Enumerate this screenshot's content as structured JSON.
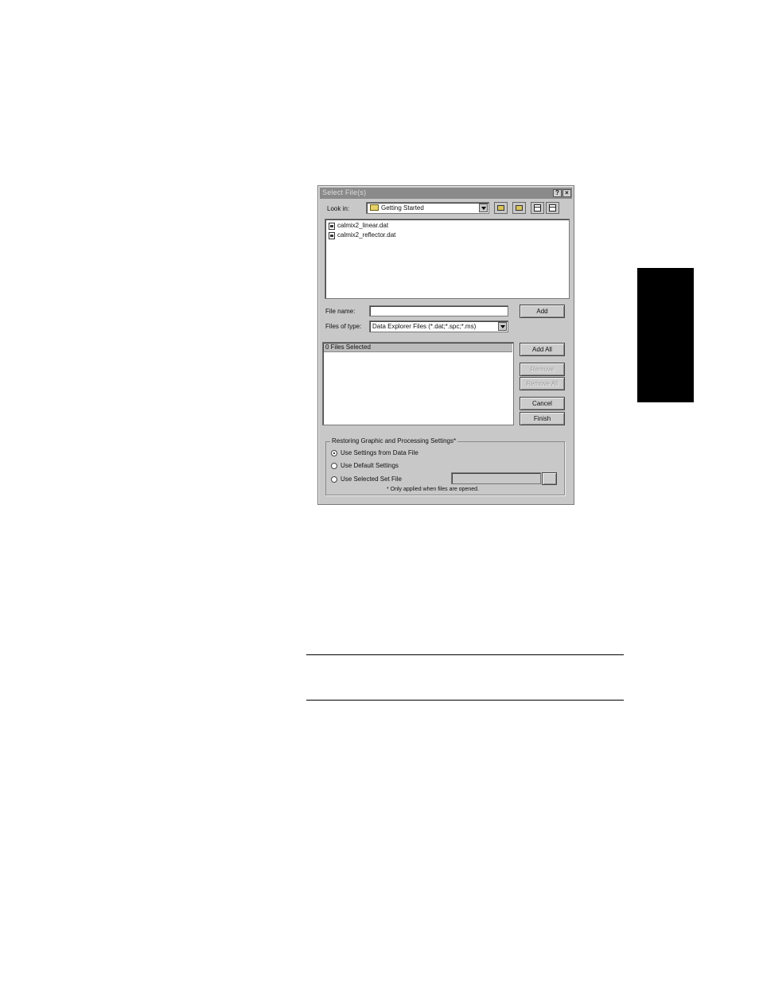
{
  "dialog": {
    "title": "Select File(s)",
    "help_label": "?",
    "close_label": "×",
    "look_in_label": "Look in:",
    "look_in_value": "Getting Started",
    "files": [
      {
        "name": "calmix2_linear.dat"
      },
      {
        "name": "calmix2_reflector.dat"
      }
    ],
    "file_name_label": "File name:",
    "file_name_value": "",
    "files_of_type_label": "Files of type:",
    "files_of_type_value": "Data Explorer Files (*.dat;*.spc;*.ms)",
    "add_label": "Add",
    "add_all_label": "Add All",
    "remove_label": "Remove",
    "remove_all_label": "Remove All",
    "cancel_label": "Cancel",
    "finish_label": "Finish",
    "selected_header": "0 Files Selected",
    "settings_group_title": "Restoring Graphic and Processing Settings*",
    "radio_options": [
      {
        "label": "Use Settings from Data File",
        "checked": true
      },
      {
        "label": "Use Default Settings",
        "checked": false
      },
      {
        "label": "Use Selected Set File",
        "checked": false
      }
    ],
    "set_file_value": "",
    "browse_label": "",
    "note": "* Only applied when files are opened."
  }
}
